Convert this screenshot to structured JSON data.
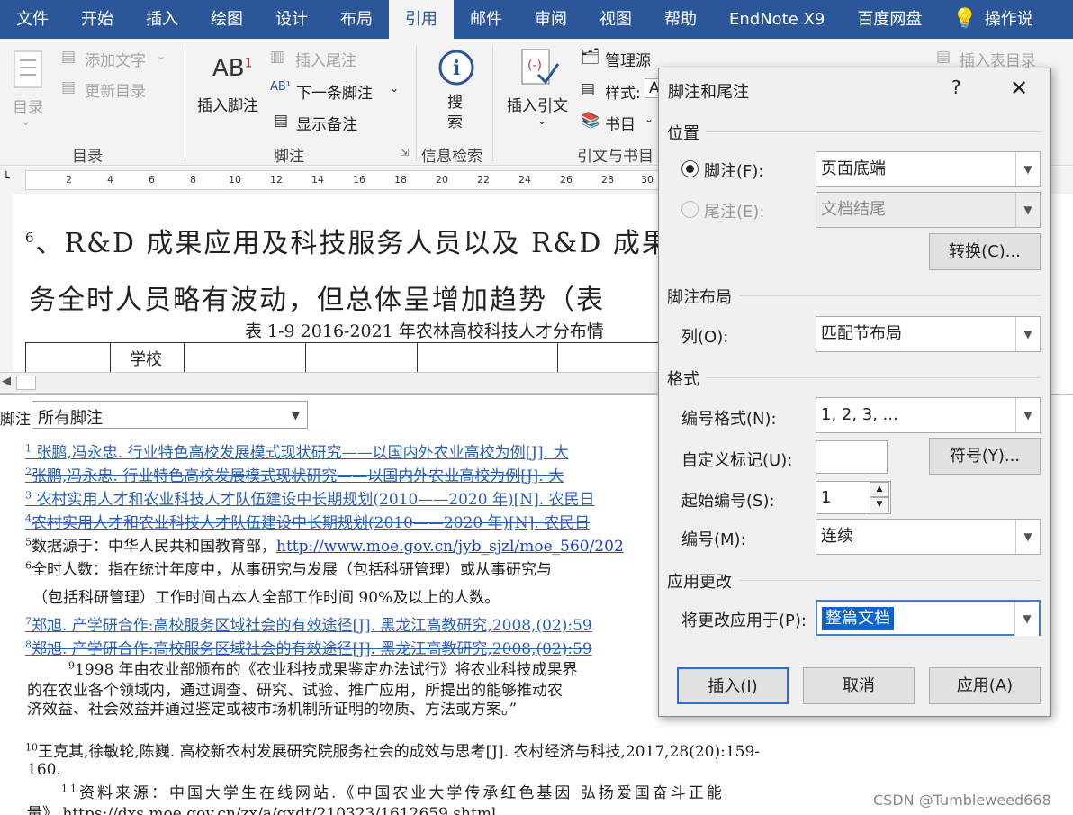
{
  "ribbon_tabs": [
    "文件",
    "开始",
    "插入",
    "绘图",
    "设计",
    "布局",
    "引用",
    "邮件",
    "审阅",
    "视图",
    "帮助",
    "EndNote X9",
    "百度网盘",
    "操作说"
  ],
  "active_tab_index": 6,
  "ribbon": {
    "toc": {
      "big": "目录",
      "add_text": "添加文字",
      "update": "更新目录",
      "group": "目录"
    },
    "footnotes": {
      "insert_footnote": "插入脚注",
      "insert_endnote": "插入尾注",
      "next_footnote": "下一条脚注",
      "show_notes": "显示备注",
      "group": "脚注"
    },
    "research": {
      "search": "搜索",
      "group": "信息检索"
    },
    "citations": {
      "insert_citation": "插入引文",
      "manage_sources": "管理源",
      "style": "样式:",
      "style_value": "A",
      "bibliography": "书目",
      "group": "引文与书目"
    },
    "captions": {
      "insert_table_of_figures": "插入表目录"
    }
  },
  "ruler_numbers": [
    "2",
    "4",
    "6",
    "8",
    "10",
    "12",
    "14",
    "16",
    "18",
    "20",
    "22",
    "24",
    "26",
    "28",
    "30"
  ],
  "document": {
    "line1_sup": "6",
    "line1": "、R&D 成果应用及科技服务人员以及 R&D 成果",
    "line2": "务全时人员略有波动，但总体呈增加趋势（表",
    "caption": "表 1-9   2016-2021 年农林高校科技人才分布情",
    "table_header_cell": "学校"
  },
  "footnote_pane": {
    "label": "脚注",
    "filter": "所有脚注",
    "notes": [
      {
        "num": "1",
        "text": " 张鹏,冯永忠. 行业特色高校发展模式现状研究——以国内外农业高校为例[J]. 大"
      },
      {
        "num": "2",
        "text": "张鹏,冯永忠. 行业特色高校发展模式现状研究——以国内外农业高校为例[J]. 大"
      },
      {
        "num": "3",
        "text": " 农村实用人才和农业科技人才队伍建设中长期规划(2010——2020 年)[N]. 农民日"
      },
      {
        "num": "4",
        "text": "农村实用人才和农业科技人才队伍建设中长期规划(2010——2020 年)[N]. 农民日"
      },
      {
        "num": "5",
        "text": "数据源于：中华人民共和国教育部，",
        "url": "http://www.moe.gov.cn/jyb_sjzl/moe_560/202"
      },
      {
        "num": "6",
        "text": "全时人数：指在统计年度中，从事研究与发展（包括科研管理）或从事研究与",
        "cont": "（包括科研管理）工作时间占本人全部工作时间 90%及以上的人数。"
      },
      {
        "num": "7",
        "text": "郑旭. 产学研合作:高校服务区域社会的有效途径[J]. 黑龙江高教研究,2008,(02):59"
      },
      {
        "num": "8",
        "text": "郑旭. 产学研合作:高校服务区域社会的有效途径[J]. 黑龙江高教研究,2008,(02):59"
      },
      {
        "num": "9",
        "text": "1998 年由农业部颁布的《农业科技成果鉴定办法试行》将农业科技成果界",
        "cont1": "的在农业各个领域内，通过调查、研究、试验、推广应用，所提出的能够推动农",
        "cont2": "济效益、社会效益并通过鉴定或被市场机制所证明的物质、方法或方案。”"
      },
      {
        "num": "10",
        "text": "王克其,徐敏轮,陈巍. 高校新农村发展研究院服务社会的成效与思考[J]. 农村经济与科技,2017,28(20):159-",
        "cont": "160."
      },
      {
        "num": "11",
        "text": "资料来源：中国大学生在线网站.《中国农业大学传承红色基因  弘扬爱国奋斗正能",
        "cont": "量》.https://dxs.moe.gov.cn/zx/a/gxdt/210323/1612659.shtml。"
      }
    ]
  },
  "dialog": {
    "title": "脚注和尾注",
    "help": "?",
    "close": "✕",
    "position_section": "位置",
    "footnote_label": "脚注(F):",
    "footnote_value": "页面底端",
    "footnote_selected": true,
    "endnote_label": "尾注(E):",
    "endnote_value": "文档结尾",
    "convert_button": "转换(C)...",
    "layout_section": "脚注布局",
    "columns_label": "列(O):",
    "columns_value": "匹配节布局",
    "format_section": "格式",
    "number_format_label": "编号格式(N):",
    "number_format_value": "1, 2, 3, ...",
    "custom_mark_label": "自定义标记(U):",
    "custom_mark_value": "",
    "symbol_button": "符号(Y)...",
    "start_at_label": "起始编号(S):",
    "start_at_value": "1",
    "numbering_label": "编号(M):",
    "numbering_value": "连续",
    "apply_section": "应用更改",
    "apply_to_label": "将更改应用于(P):",
    "apply_to_value": "整篇文档",
    "insert_button": "插入(I)",
    "cancel_button": "取消",
    "apply_button": "应用(A)"
  },
  "watermark": "CSDN @Tumbleweed668",
  "colors": {
    "ribbon_blue": "#2b579a",
    "link_blue": "#2b5fb4",
    "selection_blue": "#0a63d0"
  }
}
